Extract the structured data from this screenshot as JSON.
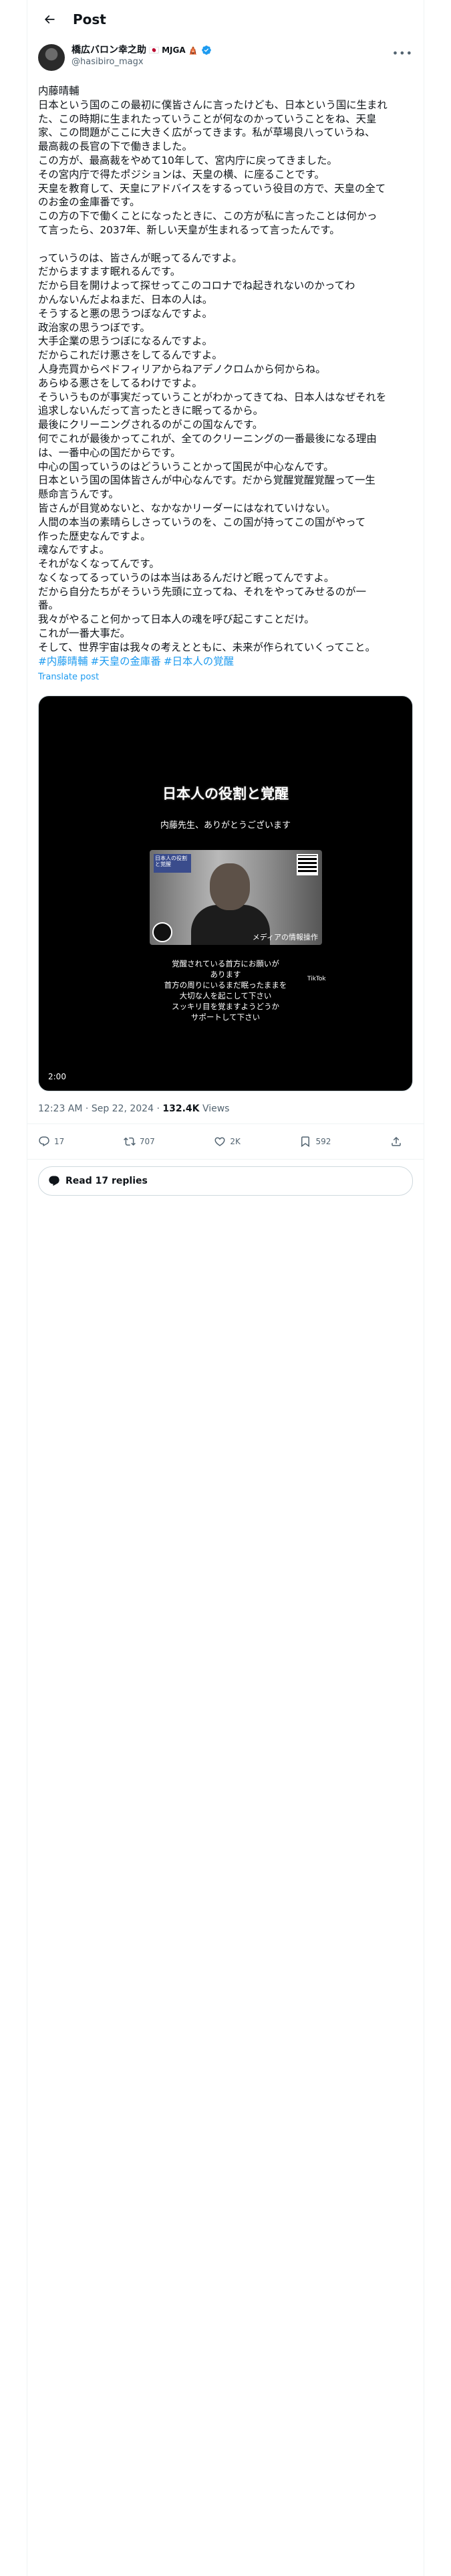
{
  "header": {
    "title": "Post"
  },
  "author": {
    "name": "橋広バロン幸之助",
    "badge": "🇯🇵 MJGA 🛕",
    "handle": "@hasibiro_magx"
  },
  "post": {
    "lines": [
      "内藤晴輔",
      "日本という国のこの最初に僕皆さんに言ったけども、日本という国に生まれ",
      "た、この時期に生まれたっていうことが何なのかっていうことをね、天皇",
      "家、この問題がここに大きく広がってきます。私が草場良八っていうね、",
      "最高裁の長官の下で働きました。",
      "この方が、最高裁をやめて10年して、宮内庁に戻ってきました。",
      "その宮内庁で得たポジションは、天皇の横、に座ることです。",
      "天皇を教育して、天皇にアドバイスをするっていう役目の方で、天皇の全て",
      "のお金の金庫番です。",
      "この方の下で働くことになったときに、この方が私に言ったことは何かっ",
      "て言ったら、2037年、新しい天皇が生まれるって言ったんです。",
      "",
      "っていうのは、皆さんが眠ってるんですよ。",
      "だからますます眠れるんです。",
      "だから目を開けよって探せってこのコロナでね起きれないのかってわ",
      "かんないんだよねまだ、日本の人は。",
      "そうすると悪の思うつぼなんですよ。",
      "政治家の思うつぼです。",
      "大手企業の思うつぼになるんですよ。",
      "だからこれだけ悪さをしてるんですよ。",
      "人身売買からペドフィリアからねアデノクロムから何からね。",
      "あらゆる悪さをしてるわけですよ。",
      "そういうものが事実だっていうことがわかってきてね、日本人はなぜそれを",
      "追求しないんだって言ったときに眠ってるから。",
      "最後にクリーニングされるのがこの国なんです。",
      "何でこれが最後かってこれが、全てのクリーニングの一番最後になる理由",
      "は、一番中心の国だからです。",
      "中心の国っていうのはどういうことかって国民が中心なんです。",
      "日本という国の国体皆さんが中心なんです。だから覚醒覚醒覚醒って一生",
      "懸命言うんです。",
      "皆さんが目覚めないと、なかなかリーダーにはなれていけない。",
      "人間の本当の素晴らしさっていうのを、この国が持ってこの国がやって",
      "作った歴史なんですよ。",
      "魂なんですよ。",
      "それがなくなってんです。",
      "なくなってるっていうのは本当はあるんだけど眠ってんですよ。",
      "だから自分たちがそういう先頭に立ってね、それをやってみせるのが一",
      "番。",
      "我々がやること何かって日本人の魂を呼び起こすことだけ。",
      "これが一番大事だ。",
      "そして、世界宇宙は我々の考えとともに、未来が作られていくってこと。"
    ],
    "hashtags": [
      "#内藤晴輔",
      "#天皇の金庫番",
      "#日本人の覚醒"
    ],
    "translate_label": "Translate post"
  },
  "video": {
    "title": "日本人の役割と覚醒",
    "subtitle": "内藤先生、ありがとうございます",
    "frame_tag": "日本人の役割と覚醒",
    "frame_caption": "メディアの情報操作",
    "caption_lines": [
      "覚醒されている首方にお願いが",
      "あります",
      "首方の周りにいるまだ眠ったままを",
      "大切な人を起こして下さい",
      "スッキリ目を覚ますようどうか",
      "サポートして下さい"
    ],
    "watermark": "TikTok",
    "duration": "2:00"
  },
  "meta": {
    "time": "12:23 AM",
    "date": "Sep 22, 2024",
    "views_count": "132.4K",
    "views_label": "Views"
  },
  "actions": {
    "replies": "17",
    "reposts": "707",
    "likes": "2K",
    "bookmarks": "592"
  },
  "read_replies_label": "Read 17 replies"
}
